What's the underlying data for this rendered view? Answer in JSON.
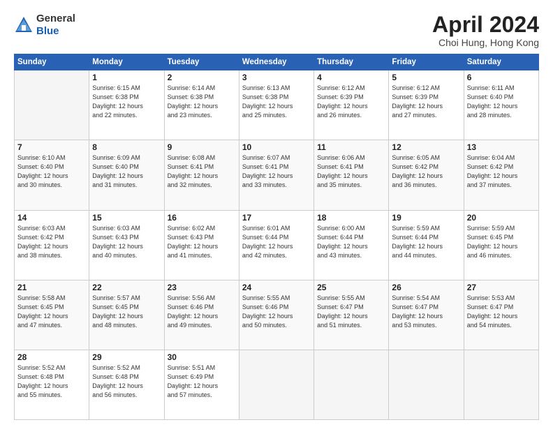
{
  "header": {
    "logo_line1": "General",
    "logo_line2": "Blue",
    "month_title": "April 2024",
    "location": "Choi Hung, Hong Kong"
  },
  "weekdays": [
    "Sunday",
    "Monday",
    "Tuesday",
    "Wednesday",
    "Thursday",
    "Friday",
    "Saturday"
  ],
  "weeks": [
    [
      {
        "day": "",
        "info": ""
      },
      {
        "day": "1",
        "info": "Sunrise: 6:15 AM\nSunset: 6:38 PM\nDaylight: 12 hours\nand 22 minutes."
      },
      {
        "day": "2",
        "info": "Sunrise: 6:14 AM\nSunset: 6:38 PM\nDaylight: 12 hours\nand 23 minutes."
      },
      {
        "day": "3",
        "info": "Sunrise: 6:13 AM\nSunset: 6:38 PM\nDaylight: 12 hours\nand 25 minutes."
      },
      {
        "day": "4",
        "info": "Sunrise: 6:12 AM\nSunset: 6:39 PM\nDaylight: 12 hours\nand 26 minutes."
      },
      {
        "day": "5",
        "info": "Sunrise: 6:12 AM\nSunset: 6:39 PM\nDaylight: 12 hours\nand 27 minutes."
      },
      {
        "day": "6",
        "info": "Sunrise: 6:11 AM\nSunset: 6:40 PM\nDaylight: 12 hours\nand 28 minutes."
      }
    ],
    [
      {
        "day": "7",
        "info": "Sunrise: 6:10 AM\nSunset: 6:40 PM\nDaylight: 12 hours\nand 30 minutes."
      },
      {
        "day": "8",
        "info": "Sunrise: 6:09 AM\nSunset: 6:40 PM\nDaylight: 12 hours\nand 31 minutes."
      },
      {
        "day": "9",
        "info": "Sunrise: 6:08 AM\nSunset: 6:41 PM\nDaylight: 12 hours\nand 32 minutes."
      },
      {
        "day": "10",
        "info": "Sunrise: 6:07 AM\nSunset: 6:41 PM\nDaylight: 12 hours\nand 33 minutes."
      },
      {
        "day": "11",
        "info": "Sunrise: 6:06 AM\nSunset: 6:41 PM\nDaylight: 12 hours\nand 35 minutes."
      },
      {
        "day": "12",
        "info": "Sunrise: 6:05 AM\nSunset: 6:42 PM\nDaylight: 12 hours\nand 36 minutes."
      },
      {
        "day": "13",
        "info": "Sunrise: 6:04 AM\nSunset: 6:42 PM\nDaylight: 12 hours\nand 37 minutes."
      }
    ],
    [
      {
        "day": "14",
        "info": "Sunrise: 6:03 AM\nSunset: 6:42 PM\nDaylight: 12 hours\nand 38 minutes."
      },
      {
        "day": "15",
        "info": "Sunrise: 6:03 AM\nSunset: 6:43 PM\nDaylight: 12 hours\nand 40 minutes."
      },
      {
        "day": "16",
        "info": "Sunrise: 6:02 AM\nSunset: 6:43 PM\nDaylight: 12 hours\nand 41 minutes."
      },
      {
        "day": "17",
        "info": "Sunrise: 6:01 AM\nSunset: 6:44 PM\nDaylight: 12 hours\nand 42 minutes."
      },
      {
        "day": "18",
        "info": "Sunrise: 6:00 AM\nSunset: 6:44 PM\nDaylight: 12 hours\nand 43 minutes."
      },
      {
        "day": "19",
        "info": "Sunrise: 5:59 AM\nSunset: 6:44 PM\nDaylight: 12 hours\nand 44 minutes."
      },
      {
        "day": "20",
        "info": "Sunrise: 5:59 AM\nSunset: 6:45 PM\nDaylight: 12 hours\nand 46 minutes."
      }
    ],
    [
      {
        "day": "21",
        "info": "Sunrise: 5:58 AM\nSunset: 6:45 PM\nDaylight: 12 hours\nand 47 minutes."
      },
      {
        "day": "22",
        "info": "Sunrise: 5:57 AM\nSunset: 6:45 PM\nDaylight: 12 hours\nand 48 minutes."
      },
      {
        "day": "23",
        "info": "Sunrise: 5:56 AM\nSunset: 6:46 PM\nDaylight: 12 hours\nand 49 minutes."
      },
      {
        "day": "24",
        "info": "Sunrise: 5:55 AM\nSunset: 6:46 PM\nDaylight: 12 hours\nand 50 minutes."
      },
      {
        "day": "25",
        "info": "Sunrise: 5:55 AM\nSunset: 6:47 PM\nDaylight: 12 hours\nand 51 minutes."
      },
      {
        "day": "26",
        "info": "Sunrise: 5:54 AM\nSunset: 6:47 PM\nDaylight: 12 hours\nand 53 minutes."
      },
      {
        "day": "27",
        "info": "Sunrise: 5:53 AM\nSunset: 6:47 PM\nDaylight: 12 hours\nand 54 minutes."
      }
    ],
    [
      {
        "day": "28",
        "info": "Sunrise: 5:52 AM\nSunset: 6:48 PM\nDaylight: 12 hours\nand 55 minutes."
      },
      {
        "day": "29",
        "info": "Sunrise: 5:52 AM\nSunset: 6:48 PM\nDaylight: 12 hours\nand 56 minutes."
      },
      {
        "day": "30",
        "info": "Sunrise: 5:51 AM\nSunset: 6:49 PM\nDaylight: 12 hours\nand 57 minutes."
      },
      {
        "day": "",
        "info": ""
      },
      {
        "day": "",
        "info": ""
      },
      {
        "day": "",
        "info": ""
      },
      {
        "day": "",
        "info": ""
      }
    ]
  ]
}
